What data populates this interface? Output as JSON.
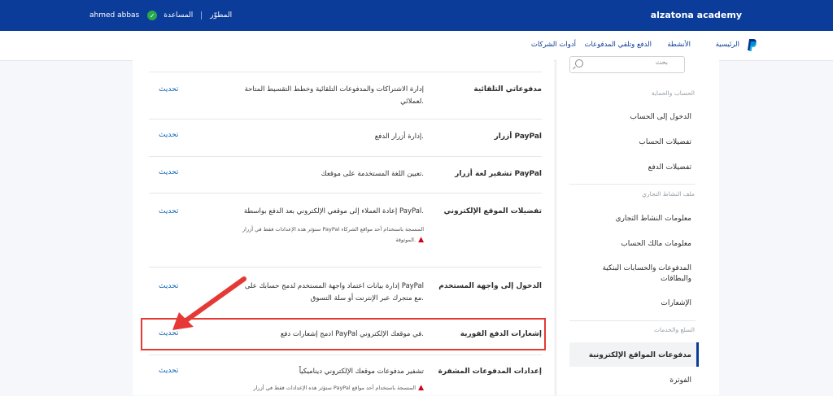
{
  "header": {
    "brand": "alzatona academy",
    "developer": "المطوّر",
    "help": "المساعدة",
    "user": "ahmed abbas"
  },
  "nav": {
    "home": "الرئيسية",
    "activity": "الأنشطة",
    "payments": "الدفع وتلقي المدفوعات",
    "tools": "أدوات الشركات"
  },
  "sidebar": {
    "search_placeholder": "بحث",
    "section_account": "الحساب والحماية",
    "login": "الدخول إلى الحساب",
    "account_prefs": "تفضيلات الحساب",
    "payment_prefs": "تفضيلات الدفع",
    "section_business": "ملف النشاط التجاري",
    "business_info": "معلومات النشاط التجاري",
    "owner_info": "معلومات مالك الحساب",
    "banks": "المدفوعات والحسابات البنكية والبطاقات",
    "notifications": "الإشعارات",
    "section_products": "السلع والخدمات",
    "website_payments": "مدفوعات المواقع الإلكترونية",
    "billing": "الفوترة"
  },
  "rows": [
    {
      "title": "مدفوعاتي التلقائية",
      "desc": "إدارة الاشتراكات والمدفوعات التلقائية وخطط التقسيط المتاحة لعملائي.",
      "link": "تحديث"
    },
    {
      "title": "أزرار PayPal",
      "desc": "إدارة أزرار الدفع.",
      "link": "تحديث"
    },
    {
      "title": "تشفير لغة أزرار PayPal",
      "desc": "تعيين اللغة المستخدمة على موقعك.",
      "link": "تحديث"
    },
    {
      "title": "تفضيلات الموقع الإلكتروني",
      "desc": "إعادة العملاء إلى موقعي الإلكتروني بعد الدفع بواسطة PayPal.",
      "link": "تحديث",
      "warn": "ستؤثر هذه الإعدادات فقط في أزرار PayPal المنسجة باستخدام أحد مواقع الشركاء الموثوقة."
    },
    {
      "title": "الدخول إلى واجهة المستخدم",
      "desc": "إدارة بيانات اعتماد واجهة المستخدم لدمج حسابك على PayPal مع متجرك عبر الإنترنت أو سلة التسوق.",
      "link": "تحديث"
    },
    {
      "title": "إشعارات الدفع الفورية",
      "desc": "ادمج إشعارات دفع PayPal في موقعك الإلكتروني.",
      "link": "تحديث"
    },
    {
      "title": "إعدادات المدفوعات المشفرة",
      "desc": "تشفير مدفوعات موقعك الإلكتروني ديناميكياً",
      "link": "تحديث",
      "warn": "ستؤثر هذه الإعدادات فقط في أزرار PayPal المنسجة باستخدام أحد مواقع"
    }
  ],
  "colors": {
    "brand_blue": "#0b3c9a",
    "link_blue": "#0b61b8",
    "highlight_red": "#e53935"
  }
}
